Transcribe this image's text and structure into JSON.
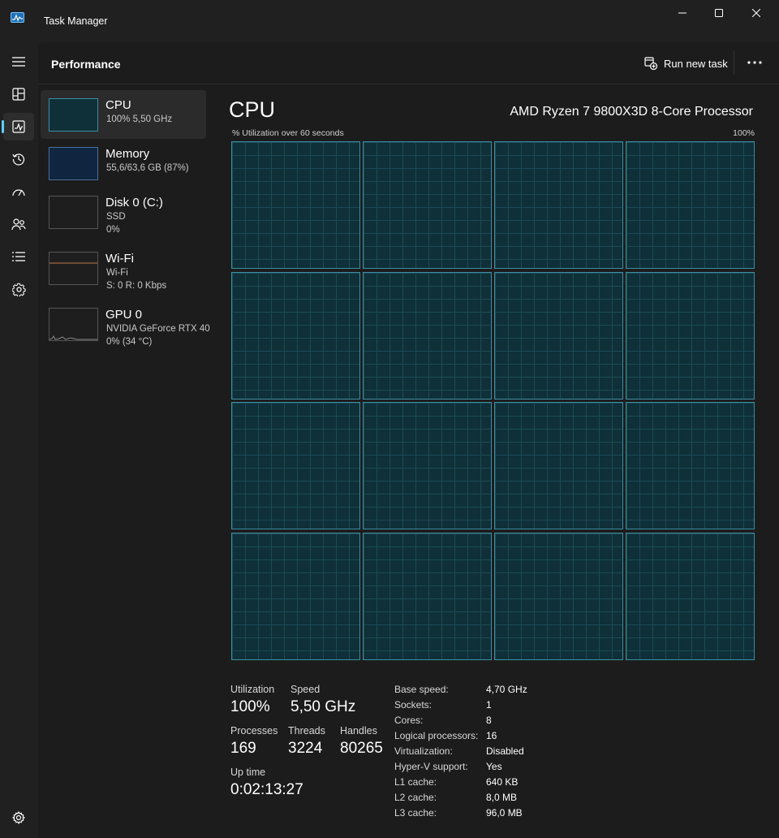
{
  "window": {
    "title": "Task Manager",
    "icon": "task-manager-app-icon",
    "controls": [
      "minimize-icon",
      "maximize-icon",
      "close-icon"
    ]
  },
  "nav": {
    "items": [
      {
        "icon": "hamburger-menu-icon"
      },
      {
        "icon": "processes-icon"
      },
      {
        "icon": "performance-icon",
        "active": true
      },
      {
        "icon": "app-history-icon"
      },
      {
        "icon": "startup-apps-icon"
      },
      {
        "icon": "users-icon"
      },
      {
        "icon": "details-icon"
      },
      {
        "icon": "services-icon"
      }
    ],
    "settings_icon": "gear-icon"
  },
  "header": {
    "title": "Performance",
    "run_new_task": "Run new task",
    "more_icon": "more-options-icon"
  },
  "devices": [
    {
      "name": "CPU",
      "lines": [
        "100%  5,50 GHz"
      ],
      "selected": true
    },
    {
      "name": "Memory",
      "lines": [
        "55,6/63,6 GB (87%)"
      ]
    },
    {
      "name": "Disk 0 (C:)",
      "lines": [
        "SSD",
        "0%"
      ]
    },
    {
      "name": "Wi-Fi",
      "lines": [
        "Wi-Fi",
        "S: 0  R: 0 Kbps"
      ]
    },
    {
      "name": "GPU 0",
      "lines": [
        "NVIDIA GeForce RTX 40",
        "0%  (34 °C)"
      ]
    }
  ],
  "detail": {
    "title": "CPU",
    "model": "AMD Ryzen 7 9800X3D 8-Core Processor",
    "graph_caption": "% Utilization over 60 seconds",
    "graph_max": "100%",
    "logical_processor_graphs": 16,
    "utilization_percent": [
      100,
      100,
      100,
      100,
      100,
      100,
      100,
      100,
      100,
      100,
      100,
      100,
      100,
      100,
      100,
      100
    ],
    "colors": {
      "graph_fill": "#0f3038",
      "graph_border": "#3a8ea3",
      "accent": "#60cdff"
    }
  },
  "stats": {
    "utilization_label": "Utilization",
    "utilization_value": "100%",
    "speed_label": "Speed",
    "speed_value": "5,50 GHz",
    "processes_label": "Processes",
    "processes_value": "169",
    "threads_label": "Threads",
    "threads_value": "3224",
    "handles_label": "Handles",
    "handles_value": "80265",
    "uptime_label": "Up time",
    "uptime_value": "0:02:13:27"
  },
  "specs": [
    {
      "key": "Base speed:",
      "value": "4,70 GHz"
    },
    {
      "key": "Sockets:",
      "value": "1"
    },
    {
      "key": "Cores:",
      "value": "8"
    },
    {
      "key": "Logical processors:",
      "value": "16"
    },
    {
      "key": "Virtualization:",
      "value": "Disabled"
    },
    {
      "key": "Hyper-V support:",
      "value": "Yes"
    },
    {
      "key": "L1 cache:",
      "value": "640 KB"
    },
    {
      "key": "L2 cache:",
      "value": "8,0 MB"
    },
    {
      "key": "L3 cache:",
      "value": "96,0 MB"
    }
  ]
}
